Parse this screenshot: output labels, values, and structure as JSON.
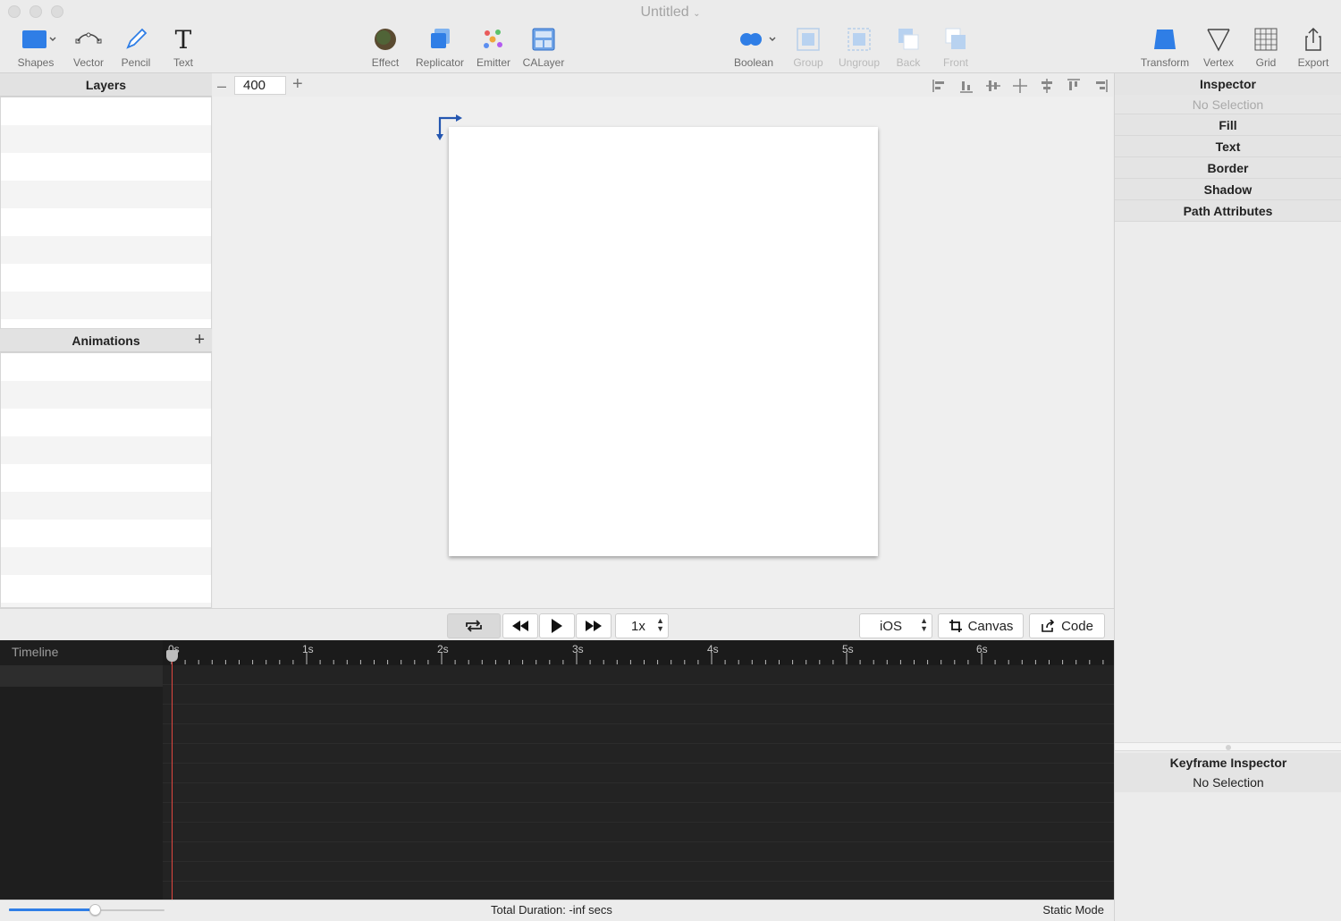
{
  "window": {
    "title": "Untitled"
  },
  "toolbar": {
    "shapes": "Shapes",
    "vector": "Vector",
    "pencil": "Pencil",
    "text": "Text",
    "effect": "Effect",
    "replicator": "Replicator",
    "emitter": "Emitter",
    "calayer": "CALayer",
    "boolean": "Boolean",
    "group": "Group",
    "ungroup": "Ungroup",
    "back": "Back",
    "front": "Front",
    "transform": "Transform",
    "vertex": "Vertex",
    "grid": "Grid",
    "export": "Export"
  },
  "layers": {
    "title": "Layers"
  },
  "animations": {
    "title": "Animations"
  },
  "canvas": {
    "zoom": "400"
  },
  "playback": {
    "speed": "1x",
    "platform": "iOS",
    "canvas_label": "Canvas",
    "code_label": "Code"
  },
  "timeline": {
    "title": "Timeline",
    "ticks": [
      "0s",
      "1s",
      "2s",
      "3s",
      "4s",
      "5s",
      "6s"
    ],
    "zoom_slider_fraction": 0.55
  },
  "status": {
    "duration": "Total Duration: -inf secs",
    "mode": "Static Mode"
  },
  "inspector": {
    "title": "Inspector",
    "selection": "No Selection",
    "sections": [
      "Fill",
      "Text",
      "Border",
      "Shadow",
      "Path Attributes"
    ]
  },
  "keyframe_inspector": {
    "title": "Keyframe Inspector",
    "selection": "No Selection"
  },
  "colors": {
    "accent": "#2f7ee6",
    "playhead": "#e0463f",
    "timeline_bg": "#1b1b1b"
  },
  "icons": {
    "shapes": "rectangle-icon",
    "vector": "bezier-icon",
    "pencil": "pencil-icon",
    "text": "text-T-icon",
    "effect": "effect-icon",
    "replicator": "replicator-icon",
    "emitter": "emitter-icon",
    "calayer": "layer-icon",
    "boolean": "boolean-icon",
    "group": "group-icon",
    "ungroup": "ungroup-icon",
    "back": "send-back-icon",
    "front": "bring-front-icon",
    "transform": "transform-icon",
    "vertex": "vertex-icon",
    "grid": "grid-icon",
    "export": "share-icon"
  }
}
